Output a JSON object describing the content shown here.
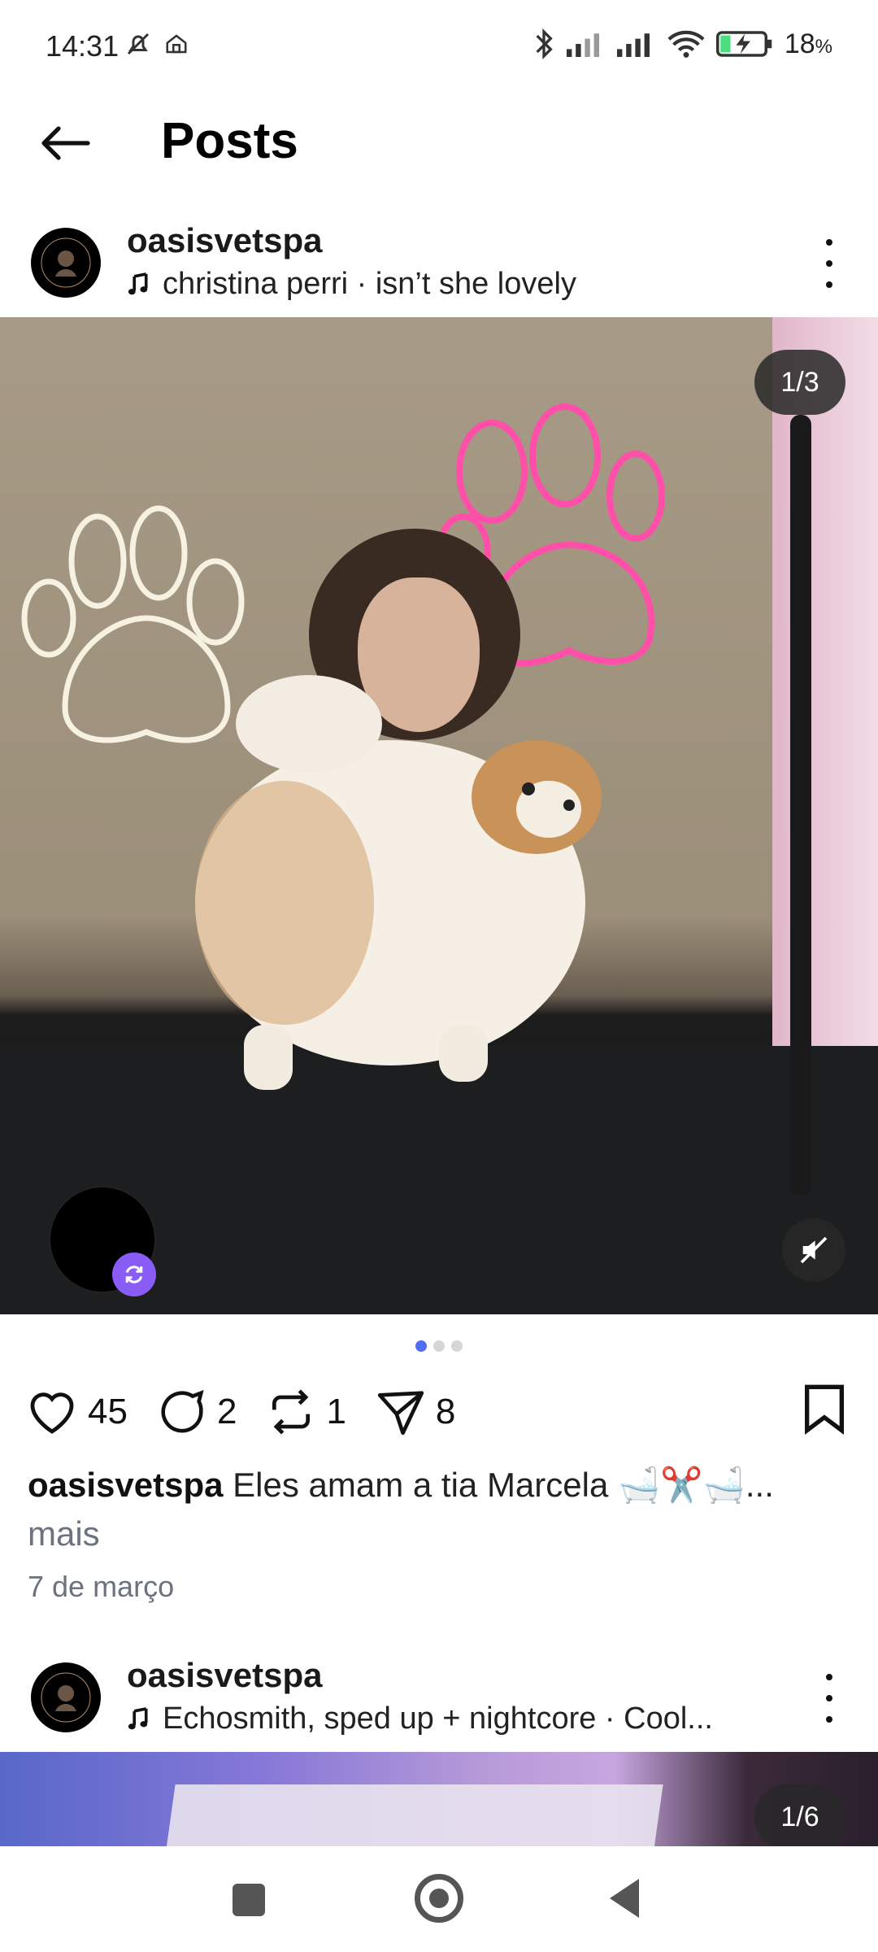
{
  "status_bar": {
    "time": "14:31",
    "battery": "18",
    "battery_unit": "%",
    "icons": [
      "mute-icon",
      "home-icon",
      "bluetooth-icon",
      "signal-icon",
      "signal-icon",
      "wifi-icon",
      "battery-charging-icon"
    ]
  },
  "header": {
    "title": "Posts",
    "back_icon": "arrow-left-icon"
  },
  "post1": {
    "username": "oasisvetspa",
    "music": "christina perri · isn’t she lovely",
    "image_counter": "1/3",
    "carousel_total": 3,
    "carousel_active": 0,
    "likes": "45",
    "comments": "2",
    "reposts": "1",
    "shares": "8",
    "caption_user": "oasisvetspa",
    "caption_text": "Eles amam a tia Marcela 🛁✂️🛁...",
    "more_label": "mais",
    "date": "7 de março"
  },
  "post2": {
    "username": "oasisvetspa",
    "music": "Echosmith, sped up + nightcore · Cool...",
    "image_counter": "1/6"
  },
  "colors": {
    "accent": "#4f6df5",
    "repost_badge": "#8a5cf6",
    "muted_text": "#6b7280"
  }
}
